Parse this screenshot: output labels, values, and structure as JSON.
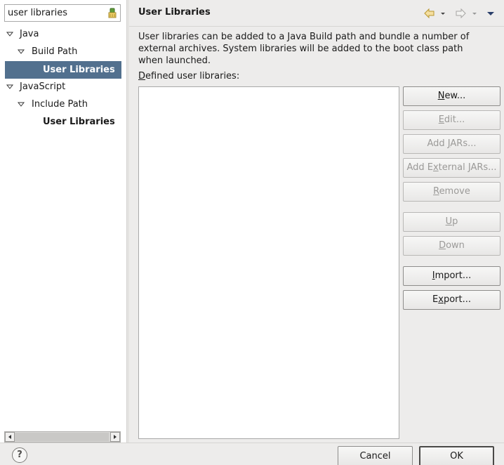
{
  "filter": {
    "value": "user libraries"
  },
  "tree": [
    {
      "label": "Java"
    },
    {
      "label": "Build Path"
    },
    {
      "label": "User Libraries"
    },
    {
      "label": "JavaScript"
    },
    {
      "label": "Include Path"
    },
    {
      "label": "User Libraries"
    }
  ],
  "page": {
    "title": "User Libraries",
    "description": "User libraries can be added to a Java Build path and bundle a number of external archives. System libraries will be added to the boot class path when launched.",
    "list_label_first": "D",
    "list_label_rest": "efined user libraries:"
  },
  "buttons": {
    "new": {
      "pre": "",
      "u": "N",
      "post": "ew..."
    },
    "edit": {
      "pre": "",
      "u": "E",
      "post": "dit..."
    },
    "add_jars": {
      "pre": "Add ",
      "u": "J",
      "post": "ARs..."
    },
    "add_external_jars": {
      "pre": "Add E",
      "u": "x",
      "post": "ternal JARs..."
    },
    "remove": {
      "pre": "",
      "u": "R",
      "post": "emove"
    },
    "up": {
      "pre": "",
      "u": "U",
      "post": "p"
    },
    "down": {
      "pre": "",
      "u": "D",
      "post": "own"
    },
    "import": {
      "pre": "",
      "u": "I",
      "post": "mport..."
    },
    "export": {
      "pre": "E",
      "u": "x",
      "post": "port..."
    }
  },
  "dialog": {
    "help": "?",
    "cancel": "Cancel",
    "ok": "OK"
  },
  "colors": {
    "selection": "#52708e",
    "background": "#edeceb"
  }
}
